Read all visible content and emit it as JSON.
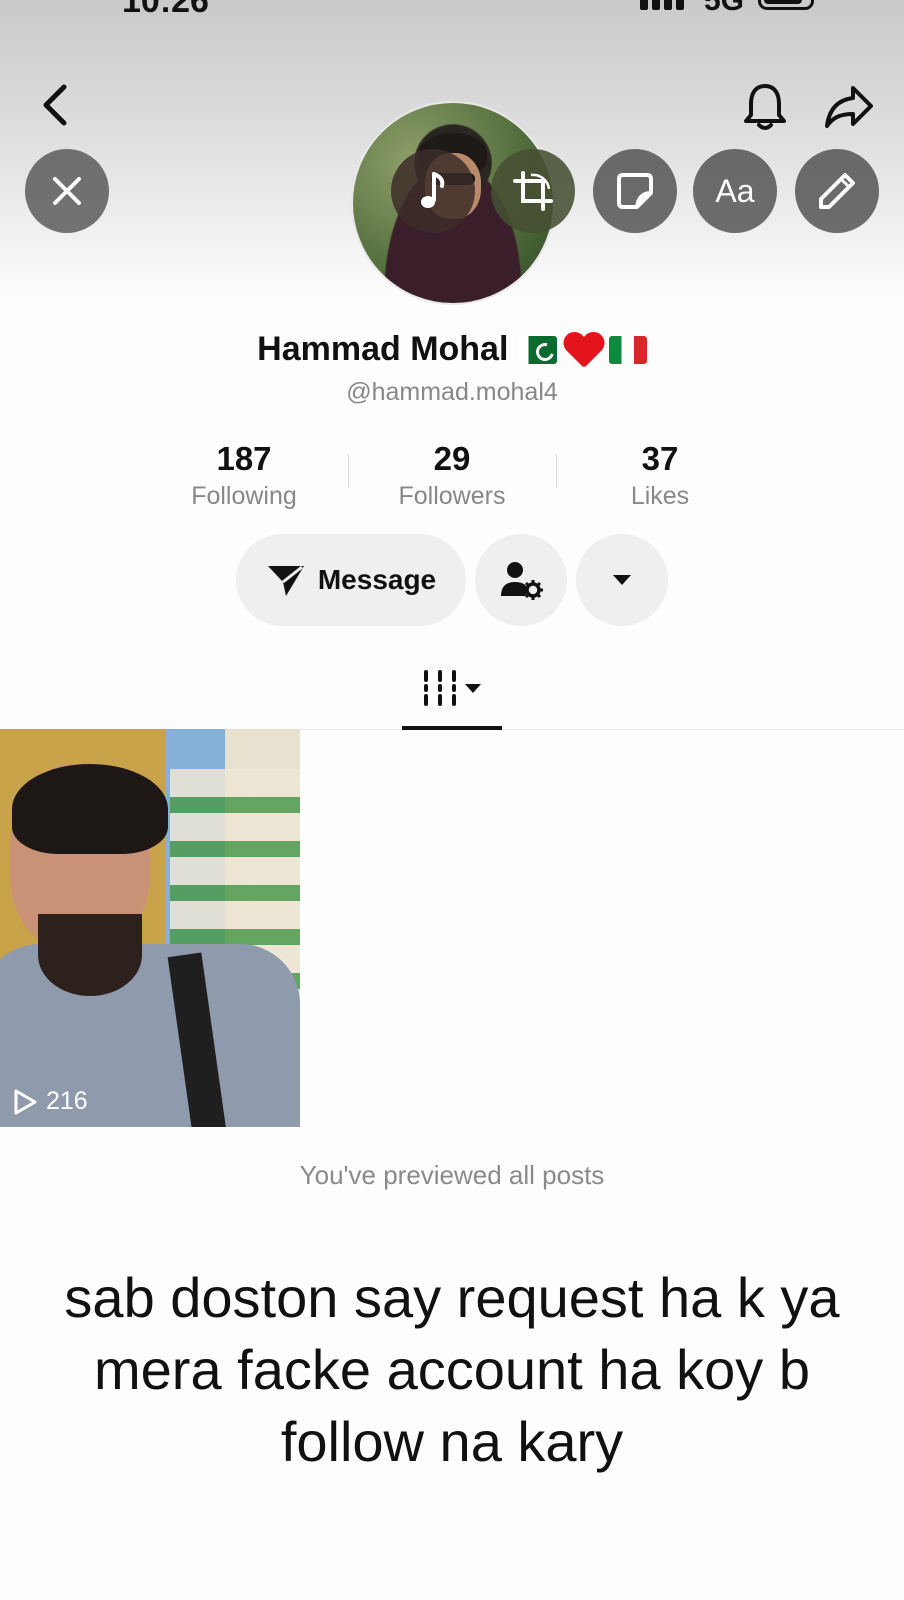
{
  "status_bar": {
    "time": "10:26",
    "network": "5G"
  },
  "profile": {
    "name": "Hammad Mohal",
    "handle": "@hammad.mohal4",
    "name_emojis": [
      "pakistan-flag",
      "red-heart",
      "italy-flag"
    ]
  },
  "stats": [
    {
      "number": "187",
      "label": "Following"
    },
    {
      "number": "29",
      "label": "Followers"
    },
    {
      "number": "37",
      "label": "Likes"
    }
  ],
  "actions": {
    "message_label": "Message"
  },
  "editor_tools": {
    "text_tool_label": "Aa"
  },
  "posts": [
    {
      "views": "216"
    }
  ],
  "end_note": "You've previewed all posts",
  "caption": "sab doston say request ha k ya mera facke account ha koy b follow na kary",
  "colors": {
    "accent_text": "#111111",
    "muted_text": "#888888",
    "button_bg": "#efefef"
  }
}
